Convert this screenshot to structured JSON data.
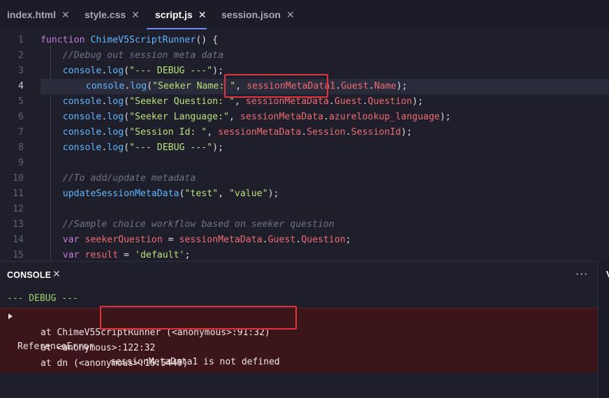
{
  "tabs": [
    {
      "label": "index.html",
      "close": "✕",
      "active": false
    },
    {
      "label": "style.css",
      "close": "✕",
      "active": false
    },
    {
      "label": "script.js",
      "close": "✕",
      "active": true
    },
    {
      "label": "session.json",
      "close": "✕",
      "active": false
    }
  ],
  "editor": {
    "current_line": 4,
    "lines": [
      {
        "n": "1",
        "tokens": [
          [
            "kw",
            "function "
          ],
          [
            "fn",
            "ChimeV5ScriptRunner"
          ],
          [
            "pl",
            "() {"
          ]
        ]
      },
      {
        "n": "2",
        "tokens": [
          [
            "cm",
            "    //Debug out session meta data"
          ]
        ]
      },
      {
        "n": "3",
        "tokens": [
          [
            "pl",
            "    "
          ],
          [
            "fn",
            "console"
          ],
          [
            "pl",
            "."
          ],
          [
            "fn",
            "log"
          ],
          [
            "pl",
            "("
          ],
          [
            "str",
            "\"--- DEBUG ---\""
          ],
          [
            "pl",
            ");"
          ]
        ]
      },
      {
        "n": "4",
        "tokens": [
          [
            "pl",
            "    "
          ],
          [
            "fn",
            "console"
          ],
          [
            "pl",
            "."
          ],
          [
            "fn",
            "log"
          ],
          [
            "pl",
            "("
          ],
          [
            "str",
            "\"Seeker Name: \""
          ],
          [
            "pl",
            ", "
          ],
          [
            "obj",
            "sessionMetaData1"
          ],
          [
            "pl",
            "."
          ],
          [
            "obj",
            "Guest"
          ],
          [
            "pl",
            "."
          ],
          [
            "obj",
            "Name"
          ],
          [
            "pl",
            ");"
          ]
        ]
      },
      {
        "n": "5",
        "tokens": [
          [
            "pl",
            "    "
          ],
          [
            "fn",
            "console"
          ],
          [
            "pl",
            "."
          ],
          [
            "fn",
            "log"
          ],
          [
            "pl",
            "("
          ],
          [
            "str",
            "\"Seeker Question: \""
          ],
          [
            "pl",
            ", "
          ],
          [
            "obj",
            "sessionMetaData"
          ],
          [
            "pl",
            "."
          ],
          [
            "obj",
            "Guest"
          ],
          [
            "pl",
            "."
          ],
          [
            "obj",
            "Question"
          ],
          [
            "pl",
            ");"
          ]
        ]
      },
      {
        "n": "6",
        "tokens": [
          [
            "pl",
            "    "
          ],
          [
            "fn",
            "console"
          ],
          [
            "pl",
            "."
          ],
          [
            "fn",
            "log"
          ],
          [
            "pl",
            "("
          ],
          [
            "str",
            "\"Seeker Language:\""
          ],
          [
            "pl",
            ", "
          ],
          [
            "obj",
            "sessionMetaData"
          ],
          [
            "pl",
            "."
          ],
          [
            "obj",
            "azurelookup_language"
          ],
          [
            "pl",
            ");"
          ]
        ]
      },
      {
        "n": "7",
        "tokens": [
          [
            "pl",
            "    "
          ],
          [
            "fn",
            "console"
          ],
          [
            "pl",
            "."
          ],
          [
            "fn",
            "log"
          ],
          [
            "pl",
            "("
          ],
          [
            "str",
            "\"Session Id: \""
          ],
          [
            "pl",
            ", "
          ],
          [
            "obj",
            "sessionMetaData"
          ],
          [
            "pl",
            "."
          ],
          [
            "obj",
            "Session"
          ],
          [
            "pl",
            "."
          ],
          [
            "obj",
            "SessionId"
          ],
          [
            "pl",
            ");"
          ]
        ]
      },
      {
        "n": "8",
        "tokens": [
          [
            "pl",
            "    "
          ],
          [
            "fn",
            "console"
          ],
          [
            "pl",
            "."
          ],
          [
            "fn",
            "log"
          ],
          [
            "pl",
            "("
          ],
          [
            "str",
            "\"--- DEBUG ---\""
          ],
          [
            "pl",
            ");"
          ]
        ]
      },
      {
        "n": "9",
        "tokens": []
      },
      {
        "n": "10",
        "tokens": [
          [
            "cm",
            "    //To add/update metadata"
          ]
        ]
      },
      {
        "n": "11",
        "tokens": [
          [
            "pl",
            "    "
          ],
          [
            "fn",
            "updateSessionMetaData"
          ],
          [
            "pl",
            "("
          ],
          [
            "str",
            "\"test\""
          ],
          [
            "pl",
            ", "
          ],
          [
            "str",
            "\"value\""
          ],
          [
            "pl",
            ");"
          ]
        ]
      },
      {
        "n": "12",
        "tokens": []
      },
      {
        "n": "13",
        "tokens": [
          [
            "cm",
            "    //Sample choice workflow based on seeker question"
          ]
        ]
      },
      {
        "n": "14",
        "tokens": [
          [
            "pl",
            "    "
          ],
          [
            "kw",
            "var "
          ],
          [
            "obj",
            "seekerQuestion"
          ],
          [
            "pl",
            " = "
          ],
          [
            "obj",
            "sessionMetaData"
          ],
          [
            "pl",
            "."
          ],
          [
            "obj",
            "Guest"
          ],
          [
            "pl",
            "."
          ],
          [
            "obj",
            "Question"
          ],
          [
            "pl",
            ";"
          ]
        ]
      },
      {
        "n": "15",
        "tokens": [
          [
            "pl",
            "    "
          ],
          [
            "kw",
            "var "
          ],
          [
            "obj",
            "result"
          ],
          [
            "pl",
            " = "
          ],
          [
            "str",
            "'default'"
          ],
          [
            "pl",
            ";"
          ]
        ]
      }
    ]
  },
  "console": {
    "title": "CONSOLE",
    "close": "✕",
    "more": "···",
    "debug_line": "--- DEBUG ---",
    "error": {
      "type": "ReferenceError",
      "message": "sessionMetaData1 is not defined",
      "stack": [
        "at ChimeV5ScriptRunner (<anonymous>:91:32)",
        "at <anonymous>:122:32",
        "at dn (<anonymous>:16:5449)"
      ]
    }
  },
  "right_panel": {
    "label": "V"
  },
  "colors": {
    "highlight": "#e0343f",
    "tab_indicator": "#6a8cff",
    "error_background": "#3b1518"
  }
}
